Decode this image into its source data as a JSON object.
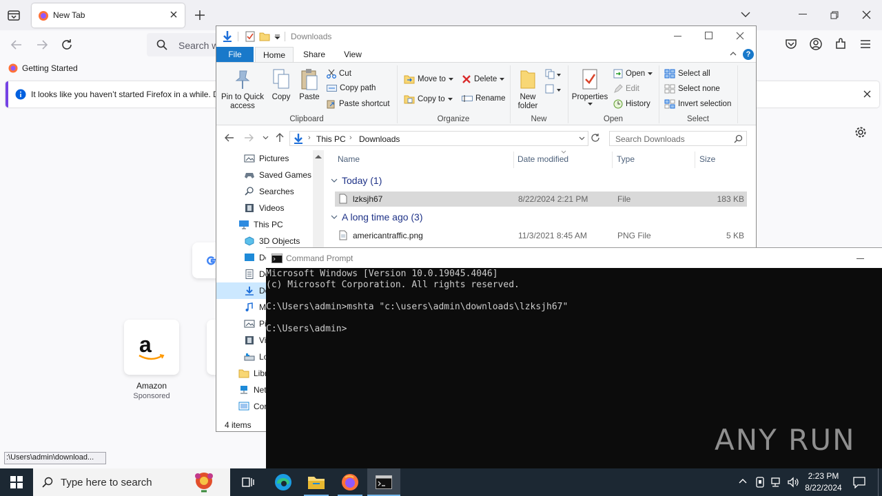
{
  "firefox": {
    "tab_title": "New Tab",
    "url_placeholder": "Search w",
    "bookmark": "Getting Started",
    "infobar_text": "It looks like you haven’t started Firefox in a while. D",
    "shortcuts": [
      {
        "title": "Amazon",
        "subtitle": "Sponsored"
      }
    ],
    "status_link": ":\\Users\\admin\\download..."
  },
  "explorer": {
    "window_title": "Downloads",
    "ribbon_tabs": [
      "File",
      "Home",
      "Share",
      "View"
    ],
    "clipboard": {
      "pin": "Pin to Quick access",
      "copy": "Copy",
      "paste": "Paste",
      "cut": "Cut",
      "copy_path": "Copy path",
      "paste_shortcut": "Paste shortcut",
      "label": "Clipboard"
    },
    "organize": {
      "move_to": "Move to",
      "copy_to": "Copy to",
      "delete": "Delete",
      "rename": "Rename",
      "label": "Organize"
    },
    "new": {
      "new_folder": "New folder",
      "label": "New"
    },
    "open": {
      "properties": "Properties",
      "open": "Open",
      "edit": "Edit",
      "history": "History",
      "label": "Open"
    },
    "select": {
      "select_all": "Select all",
      "select_none": "Select none",
      "invert": "Invert selection",
      "label": "Select"
    },
    "breadcrumb": [
      "This PC",
      "Downloads"
    ],
    "search_placeholder": "Search Downloads",
    "nav_items": [
      "Pictures",
      "Saved Games",
      "Searches",
      "Videos",
      "This PC",
      "3D Objects",
      "De",
      "Do",
      "Do",
      "M",
      "Pi",
      "Vi",
      "Lo",
      "Libr",
      "Net",
      "Cor"
    ],
    "columns": [
      "Name",
      "Date modified",
      "Type",
      "Size"
    ],
    "groups": [
      {
        "label": "Today (1)",
        "files": [
          {
            "name": "lzksjh67",
            "date": "8/22/2024 2:21 PM",
            "type": "File",
            "size": "183 KB"
          }
        ]
      },
      {
        "label": "A long time ago (3)",
        "files": [
          {
            "name": "americantraffic.png",
            "date": "11/3/2021 8:45 AM",
            "type": "PNG File",
            "size": "5 KB"
          }
        ]
      }
    ],
    "status": "4 items"
  },
  "cmd": {
    "title": "Command Prompt",
    "lines": [
      "Microsoft Windows [Version 10.0.19045.4046]",
      "(c) Microsoft Corporation. All rights reserved.",
      "",
      "C:\\Users\\admin>mshta \"c:\\users\\admin\\downloads\\lzksjh67\"",
      "",
      "C:\\Users\\admin>"
    ]
  },
  "watermark": "ANY RUN",
  "taskbar": {
    "search_placeholder": "Type here to search",
    "time": "2:23 PM",
    "date": "8/22/2024"
  }
}
